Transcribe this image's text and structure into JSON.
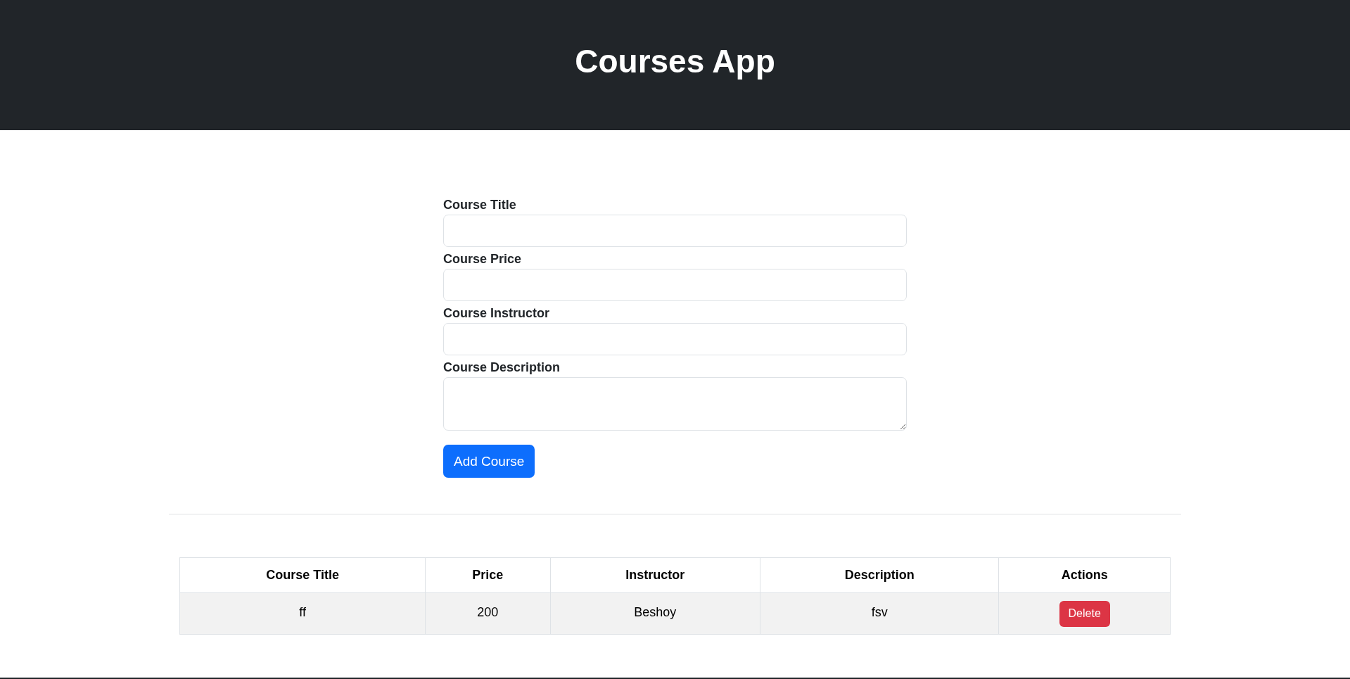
{
  "header": {
    "title": "Courses App"
  },
  "form": {
    "fields": [
      {
        "label": "Course Title",
        "kind": "input"
      },
      {
        "label": "Course Price",
        "kind": "input"
      },
      {
        "label": "Course Instructor",
        "kind": "input"
      },
      {
        "label": "Course Description",
        "kind": "textarea"
      }
    ],
    "submit_button": "Add Course"
  },
  "table": {
    "columns": [
      "Course Title",
      "Price",
      "Instructor",
      "Description",
      "Actions"
    ],
    "rows": [
      {
        "cells": [
          "ff",
          "200",
          "Beshoy",
          "fsv"
        ],
        "action_button": "Delete"
      }
    ]
  }
}
